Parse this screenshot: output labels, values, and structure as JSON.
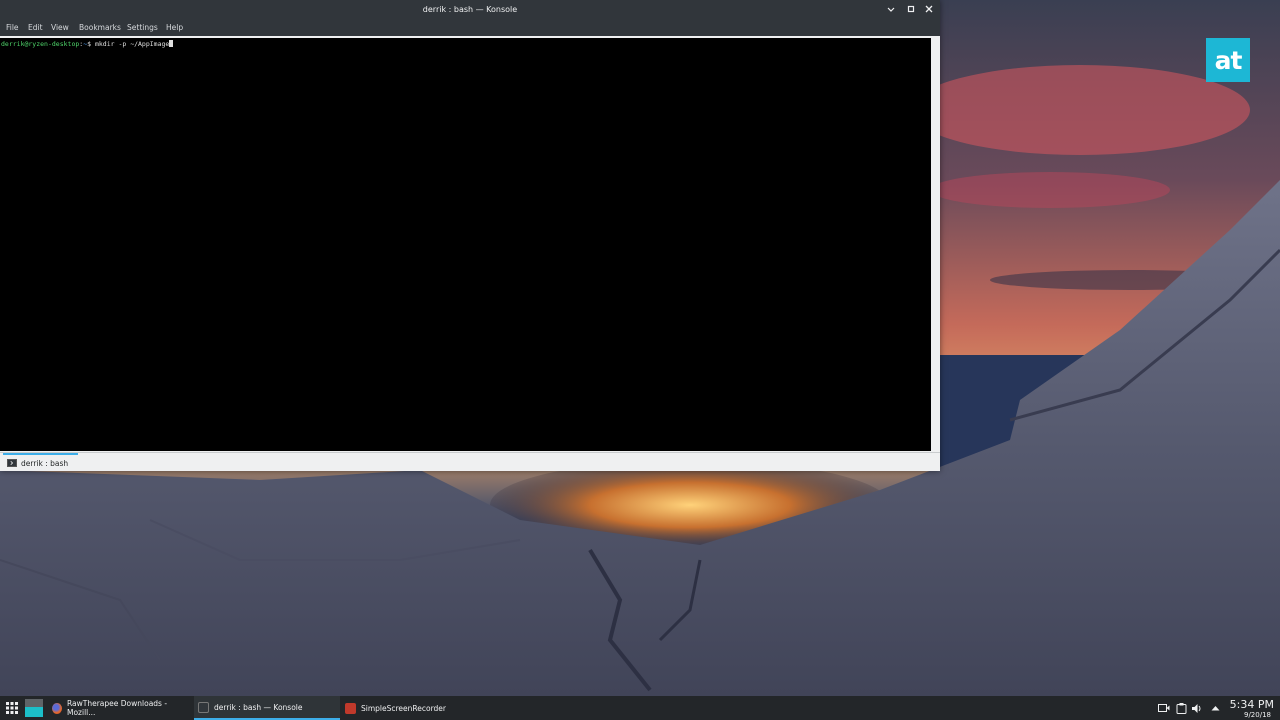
{
  "window": {
    "title": "derrik : bash — Konsole",
    "menu": [
      "File",
      "Edit",
      "View",
      "Bookmarks",
      "Settings",
      "Help"
    ]
  },
  "terminal": {
    "prompt_user": "derrik@ryzen-desktop",
    "prompt_sep": ":",
    "prompt_path": "~",
    "prompt_symbol": "$",
    "command": "mkdir -p ~/AppImage"
  },
  "tabs": [
    {
      "label": "derrik : bash",
      "icon": "terminal-icon"
    }
  ],
  "brand": {
    "text": "at",
    "color": "#1db7d5"
  },
  "taskbar": {
    "tasks": [
      {
        "label": "RawTherapee Downloads - Mozill...",
        "icon": "firefox-icon"
      },
      {
        "label": "derrik : bash — Konsole",
        "icon": "konsole-icon",
        "active": true
      },
      {
        "label": "SimpleScreenRecorder",
        "icon": "screen-recorder-icon"
      }
    ],
    "clock": {
      "time": "5:34 PM",
      "date": "9/20/18"
    },
    "tray_icons": [
      "camera-icon",
      "clipboard-icon",
      "volume-icon",
      "expand-tray-icon"
    ]
  },
  "colors": {
    "accent": "#3daee9",
    "titlebar": "#31363b",
    "terminal_bg": "#000000",
    "prompt_green": "#4fd66b"
  }
}
